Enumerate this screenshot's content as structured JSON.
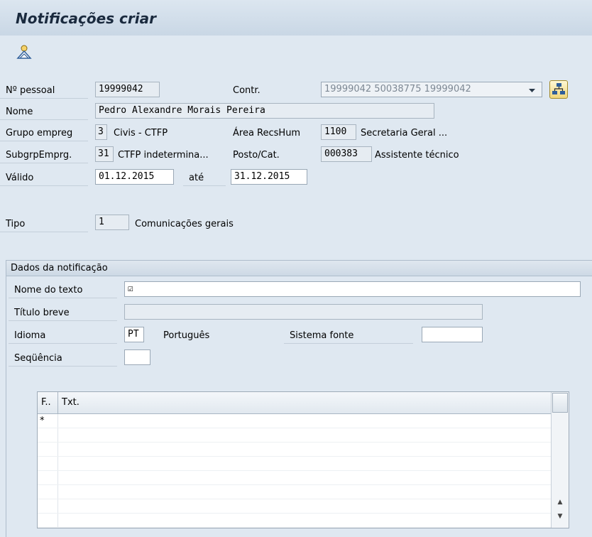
{
  "title": "Notificações criar",
  "toolbar": {
    "icon": "user-icon"
  },
  "header": {
    "pessoal": {
      "label": "Nº pessoal",
      "value": "19999042"
    },
    "contr": {
      "label": "Contr.",
      "value": "19999042 50038775 19999042"
    },
    "nome": {
      "label": "Nome",
      "value": "Pedro Alexandre Morais Pereira"
    },
    "grupo": {
      "label": "Grupo empreg",
      "code": "3",
      "text": "Civis - CTFP"
    },
    "area": {
      "label": "Área RecsHum",
      "code": "1100",
      "text": "Secretaria Geral ..."
    },
    "subgrp": {
      "label": "SubgrpEmprg.",
      "code": "31",
      "text": "CTFP indetermina..."
    },
    "posto": {
      "label": "Posto/Cat.",
      "code": "000383",
      "text": "Assistente técnico"
    },
    "valido": {
      "label": "Válido",
      "from": "01.12.2015",
      "to_label": "até",
      "to": "31.12.2015"
    },
    "tipo": {
      "label": "Tipo",
      "code": "1",
      "text": "Comunicações gerais"
    }
  },
  "notificacao": {
    "group_title": "Dados da notificação",
    "nome_texto": {
      "label": "Nome do texto",
      "value": "☑"
    },
    "titulo": {
      "label": "Título breve",
      "value": ""
    },
    "idioma": {
      "label": "Idioma",
      "code": "PT",
      "text": "Português"
    },
    "sistema": {
      "label": "Sistema fonte",
      "value": ""
    },
    "sequencia": {
      "label": "Seqüência",
      "value": ""
    }
  },
  "table": {
    "columns": [
      "F..",
      "Txt."
    ],
    "rows": [
      [
        "*",
        ""
      ],
      [
        "",
        ""
      ],
      [
        "",
        ""
      ],
      [
        "",
        ""
      ],
      [
        "",
        ""
      ],
      [
        "",
        ""
      ],
      [
        "",
        ""
      ],
      [
        "",
        ""
      ]
    ]
  }
}
